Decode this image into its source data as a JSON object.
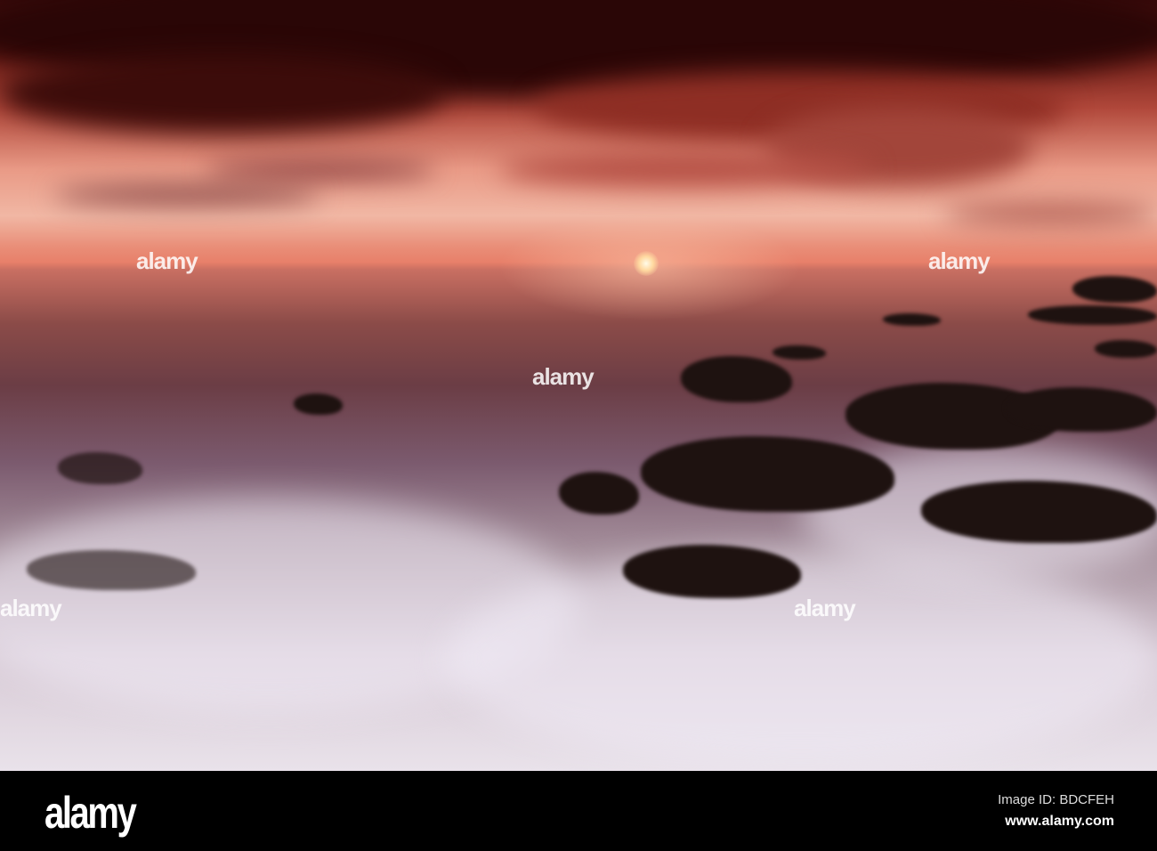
{
  "watermark": {
    "text": "alamy"
  },
  "footer": {
    "logo": "alamy",
    "image_id": "Image ID: BDCFEH",
    "website": "www.alamy.com"
  }
}
